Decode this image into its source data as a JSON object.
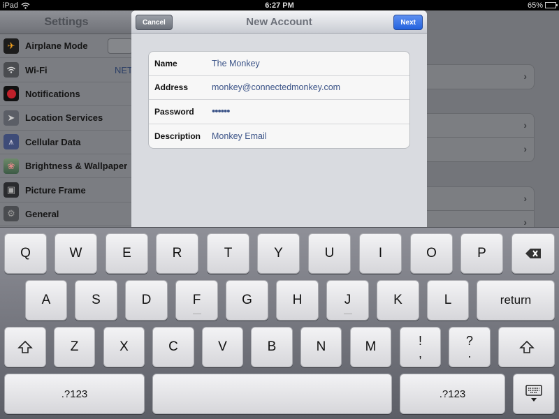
{
  "status_bar": {
    "device": "iPad",
    "time": "6:27 PM",
    "battery_percent": "65%",
    "battery_level": 0.65,
    "wifi_icon": "wifi-icon"
  },
  "settings": {
    "title": "Settings",
    "items": [
      {
        "label": "Airplane Mode",
        "icon": "airplane-icon",
        "control": "toggle"
      },
      {
        "label": "Wi-Fi",
        "icon": "wifi-icon",
        "value": "NET"
      },
      {
        "label": "Notifications",
        "icon": "notifications-icon"
      },
      {
        "label": "Location Services",
        "icon": "location-icon"
      },
      {
        "label": "Cellular Data",
        "icon": "cellular-icon"
      },
      {
        "label": "Brightness & Wallpaper",
        "icon": "brightness-wallpaper-icon"
      },
      {
        "label": "Picture Frame",
        "icon": "picture-frame-icon"
      },
      {
        "label": "General",
        "icon": "gear-icon"
      }
    ]
  },
  "modal": {
    "title": "New Account",
    "cancel_label": "Cancel",
    "next_label": "Next",
    "fields": [
      {
        "label": "Name",
        "value": "The Monkey"
      },
      {
        "label": "Address",
        "value": "monkey@connectedmonkey.com"
      },
      {
        "label": "Password",
        "value": "••••••"
      },
      {
        "label": "Description",
        "value": "Monkey Email"
      }
    ]
  },
  "keyboard": {
    "row1": [
      "Q",
      "W",
      "E",
      "R",
      "T",
      "Y",
      "U",
      "I",
      "O",
      "P"
    ],
    "row2": [
      "A",
      "S",
      "D",
      "F",
      "G",
      "H",
      "J",
      "K",
      "L"
    ],
    "row3": [
      "Z",
      "X",
      "C",
      "V",
      "B",
      "N",
      "M"
    ],
    "return_label": "return",
    "numbers_label": ".?123",
    "punct1": {
      "top": "!",
      "bottom": ","
    },
    "punct2": {
      "top": "?",
      "bottom": "."
    },
    "backspace_icon": "backspace-icon",
    "shift_icon": "shift-icon",
    "hide_keyboard_icon": "hide-keyboard-icon"
  }
}
